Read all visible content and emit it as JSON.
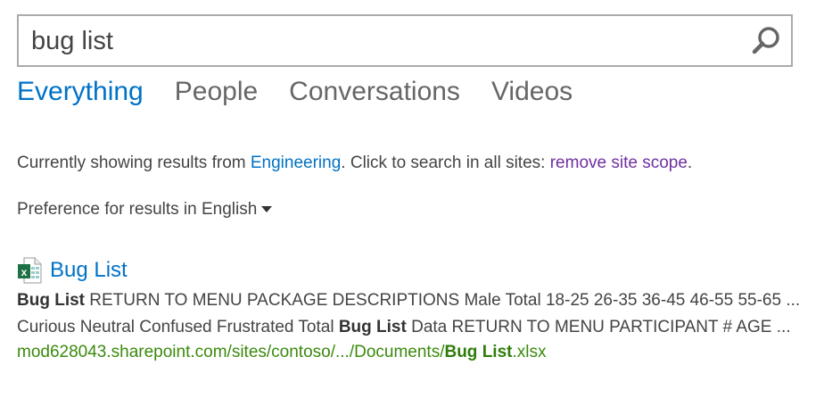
{
  "search": {
    "query": "bug list",
    "icon": "search-icon"
  },
  "tabs": [
    {
      "label": "Everything",
      "active": true
    },
    {
      "label": "People",
      "active": false
    },
    {
      "label": "Conversations",
      "active": false
    },
    {
      "label": "Videos",
      "active": false
    }
  ],
  "scope": {
    "prefix": "Currently showing results from ",
    "site": "Engineering",
    "middle": ". Click to search in all sites: ",
    "remove_link": "remove site scope",
    "suffix": "."
  },
  "preference": {
    "prefix": "Preference for results in ",
    "language": "English"
  },
  "colors": {
    "accent": "#0072c6",
    "visited_link": "#7030a0",
    "url": "#3a8a0c"
  },
  "result": {
    "icon": "excel-file-icon",
    "title": "Bug List",
    "summary": [
      {
        "text": "Bug List",
        "bold": true
      },
      {
        "text": " RETURN TO MENU PACKAGE DESCRIPTIONS Male Total 18-25 26-35 36-45 46-55 55-65 ... Curious Neutral Confused Frustrated Total ",
        "bold": false
      },
      {
        "text": "Bug List",
        "bold": true
      },
      {
        "text": " Data RETURN TO MENU PARTICIPANT # AGE ...",
        "bold": false
      }
    ],
    "url_prefix": "mod628043.sharepoint.com/sites/contoso/.../Documents/",
    "url_bold": "Bug List",
    "url_suffix": ".xlsx"
  }
}
